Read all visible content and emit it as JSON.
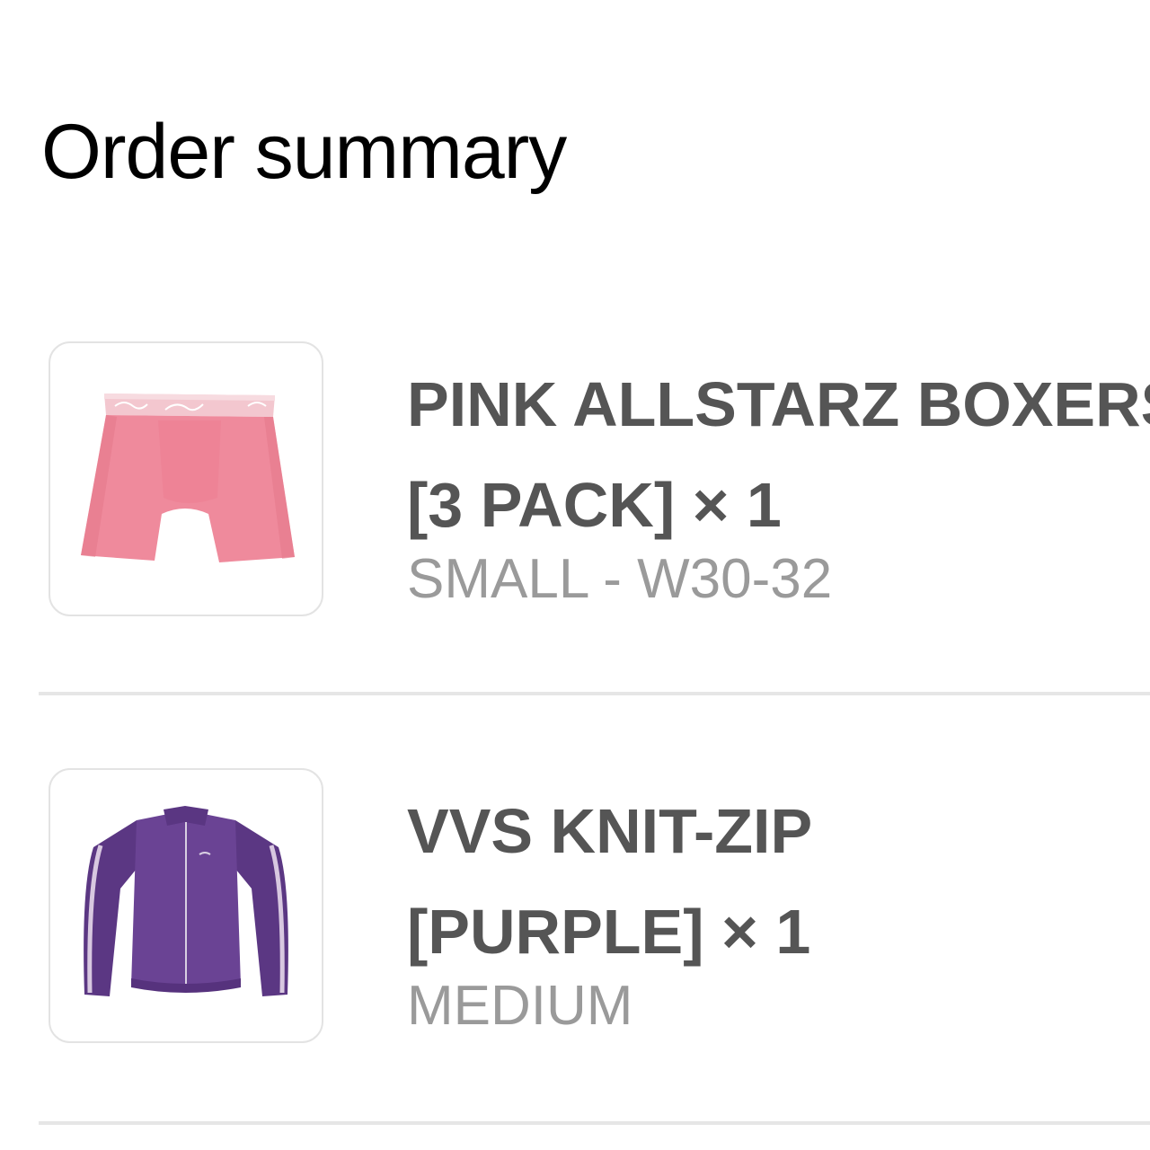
{
  "header": {
    "title": "Order summary"
  },
  "items": [
    {
      "name_line1": "PINK ALLSTARZ BOXERS",
      "name_line2": "[3 PACK] × 1",
      "variant": "SMALL - W30-32",
      "image_icon": "pink-boxer-shorts-image",
      "image_color": "#ef8a9c"
    },
    {
      "name_line1": "VVS KNIT-ZIP",
      "name_line2": "[PURPLE] × 1",
      "variant": "MEDIUM",
      "image_icon": "purple-zip-jacket-image",
      "image_color": "#5f3b86"
    }
  ]
}
